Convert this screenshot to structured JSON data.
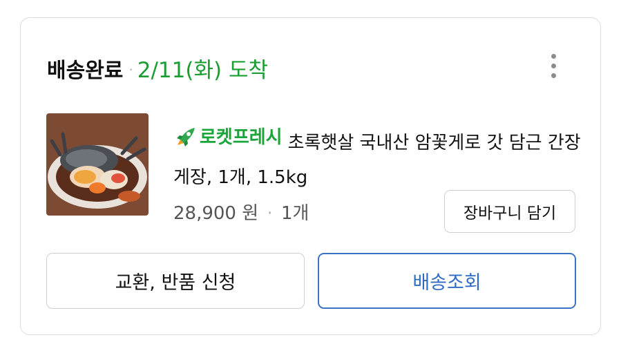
{
  "order": {
    "status": "배송완료",
    "separator": "·",
    "delivery_date": "2/11(화) 도착"
  },
  "more_menu": {
    "icon": "more-vertical-icon"
  },
  "product": {
    "image_alt": "간장게장",
    "badge_label": "로켓프레시",
    "badge_icon": "rocket-icon",
    "badge_color": "#1aa539",
    "name": "초록햇살 국내산 암꽃게로 갓 담근 간장게장, 1개, 1.5kg",
    "price": "28,900 원",
    "price_separator": "·",
    "quantity": "1개"
  },
  "actions": {
    "add_to_cart": "장바구니 담기",
    "return_request": "교환, 반품 신청",
    "track_delivery": "배송조회"
  },
  "colors": {
    "delivery_date": "#1a9d32",
    "track_button": "#2f6bc4"
  }
}
